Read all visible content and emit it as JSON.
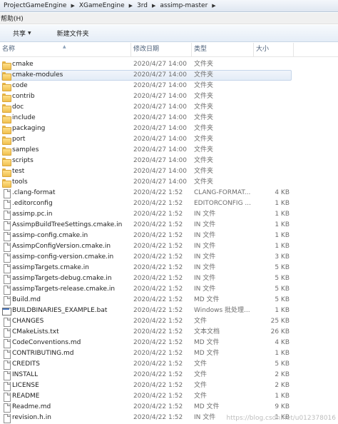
{
  "breadcrumb": [
    "ProjectGameEngine",
    "XGameEngine",
    "3rd",
    "assimp-master"
  ],
  "menu": {
    "help": "帮助(H)"
  },
  "toolbar": {
    "share_label": "共享",
    "new_folder_label": "新建文件夹"
  },
  "columns": {
    "name": "名称",
    "date": "修改日期",
    "type": "类型",
    "size": "大小"
  },
  "files": [
    {
      "name": "cmake",
      "date": "2020/4/27 14:00",
      "type": "文件夹",
      "size": "",
      "kind": "folder"
    },
    {
      "name": "cmake-modules",
      "date": "2020/4/27 14:00",
      "type": "文件夹",
      "size": "",
      "kind": "folder",
      "selected": true
    },
    {
      "name": "code",
      "date": "2020/4/27 14:00",
      "type": "文件夹",
      "size": "",
      "kind": "folder"
    },
    {
      "name": "contrib",
      "date": "2020/4/27 14:00",
      "type": "文件夹",
      "size": "",
      "kind": "folder"
    },
    {
      "name": "doc",
      "date": "2020/4/27 14:00",
      "type": "文件夹",
      "size": "",
      "kind": "folder"
    },
    {
      "name": "include",
      "date": "2020/4/27 14:00",
      "type": "文件夹",
      "size": "",
      "kind": "folder"
    },
    {
      "name": "packaging",
      "date": "2020/4/27 14:00",
      "type": "文件夹",
      "size": "",
      "kind": "folder"
    },
    {
      "name": "port",
      "date": "2020/4/27 14:00",
      "type": "文件夹",
      "size": "",
      "kind": "folder"
    },
    {
      "name": "samples",
      "date": "2020/4/27 14:00",
      "type": "文件夹",
      "size": "",
      "kind": "folder"
    },
    {
      "name": "scripts",
      "date": "2020/4/27 14:00",
      "type": "文件夹",
      "size": "",
      "kind": "folder"
    },
    {
      "name": "test",
      "date": "2020/4/27 14:00",
      "type": "文件夹",
      "size": "",
      "kind": "folder"
    },
    {
      "name": "tools",
      "date": "2020/4/27 14:00",
      "type": "文件夹",
      "size": "",
      "kind": "folder"
    },
    {
      "name": ".clang-format",
      "date": "2020/4/22 1:52",
      "type": "CLANG-FORMAT...",
      "size": "4 KB",
      "kind": "file"
    },
    {
      "name": ".editorconfig",
      "date": "2020/4/22 1:52",
      "type": "EDITORCONFIG ...",
      "size": "1 KB",
      "kind": "file"
    },
    {
      "name": "assimp.pc.in",
      "date": "2020/4/22 1:52",
      "type": "IN 文件",
      "size": "1 KB",
      "kind": "file"
    },
    {
      "name": "AssimpBuildTreeSettings.cmake.in",
      "date": "2020/4/22 1:52",
      "type": "IN 文件",
      "size": "1 KB",
      "kind": "file"
    },
    {
      "name": "assimp-config.cmake.in",
      "date": "2020/4/22 1:52",
      "type": "IN 文件",
      "size": "1 KB",
      "kind": "file"
    },
    {
      "name": "AssimpConfigVersion.cmake.in",
      "date": "2020/4/22 1:52",
      "type": "IN 文件",
      "size": "1 KB",
      "kind": "file"
    },
    {
      "name": "assimp-config-version.cmake.in",
      "date": "2020/4/22 1:52",
      "type": "IN 文件",
      "size": "3 KB",
      "kind": "file"
    },
    {
      "name": "assimpTargets.cmake.in",
      "date": "2020/4/22 1:52",
      "type": "IN 文件",
      "size": "5 KB",
      "kind": "file"
    },
    {
      "name": "assimpTargets-debug.cmake.in",
      "date": "2020/4/22 1:52",
      "type": "IN 文件",
      "size": "5 KB",
      "kind": "file"
    },
    {
      "name": "assimpTargets-release.cmake.in",
      "date": "2020/4/22 1:52",
      "type": "IN 文件",
      "size": "5 KB",
      "kind": "file"
    },
    {
      "name": "Build.md",
      "date": "2020/4/22 1:52",
      "type": "MD 文件",
      "size": "5 KB",
      "kind": "file"
    },
    {
      "name": "BUILDBINARIES_EXAMPLE.bat",
      "date": "2020/4/22 1:52",
      "type": "Windows 批处理...",
      "size": "1 KB",
      "kind": "bat"
    },
    {
      "name": "CHANGES",
      "date": "2020/4/22 1:52",
      "type": "文件",
      "size": "25 KB",
      "kind": "file"
    },
    {
      "name": "CMakeLists.txt",
      "date": "2020/4/22 1:52",
      "type": "文本文档",
      "size": "26 KB",
      "kind": "file"
    },
    {
      "name": "CodeConventions.md",
      "date": "2020/4/22 1:52",
      "type": "MD 文件",
      "size": "4 KB",
      "kind": "file"
    },
    {
      "name": "CONTRIBUTING.md",
      "date": "2020/4/22 1:52",
      "type": "MD 文件",
      "size": "1 KB",
      "kind": "file"
    },
    {
      "name": "CREDITS",
      "date": "2020/4/22 1:52",
      "type": "文件",
      "size": "5 KB",
      "kind": "file"
    },
    {
      "name": "INSTALL",
      "date": "2020/4/22 1:52",
      "type": "文件",
      "size": "2 KB",
      "kind": "file"
    },
    {
      "name": "LICENSE",
      "date": "2020/4/22 1:52",
      "type": "文件",
      "size": "2 KB",
      "kind": "file"
    },
    {
      "name": "README",
      "date": "2020/4/22 1:52",
      "type": "文件",
      "size": "1 KB",
      "kind": "file"
    },
    {
      "name": "Readme.md",
      "date": "2020/4/22 1:52",
      "type": "MD 文件",
      "size": "9 KB",
      "kind": "file"
    },
    {
      "name": "revision.h.in",
      "date": "2020/4/22 1:52",
      "type": "IN 文件",
      "size": "1 KB",
      "kind": "file"
    }
  ],
  "watermark": "https://blog.csdn.net/u012378016"
}
